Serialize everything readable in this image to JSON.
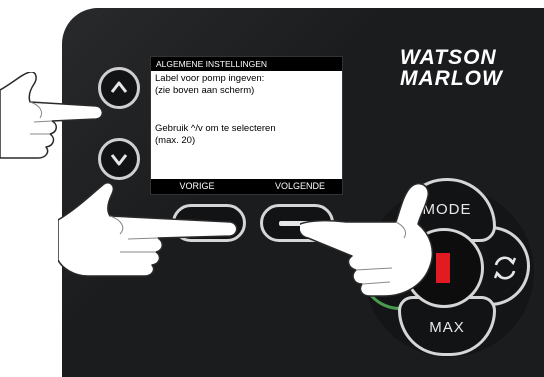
{
  "screen": {
    "title": "ALGEMENE INSTELLINGEN",
    "lines": [
      "Label voor pomp ingeven:",
      "(zie boven aan scherm)",
      "",
      "Gebruik ^/v om te selecteren",
      "(max. 20)"
    ],
    "softkeys": {
      "left": "VORIGE",
      "right": "VOLGENDE"
    }
  },
  "brand": {
    "line1": "WATSON",
    "line2": "MARLOW"
  },
  "keys": {
    "mode": "MODE",
    "max": "MAX"
  },
  "icons": {
    "up": "chevron-up-icon",
    "down": "chevron-down-icon",
    "softkey_bar": "dash-icon",
    "direction": "rotate-direction-icon",
    "stop": "stop-icon"
  },
  "colors": {
    "stop_red": "#e21b23",
    "start_green": "#4b9b4f",
    "panel": "#1b1c1e"
  }
}
